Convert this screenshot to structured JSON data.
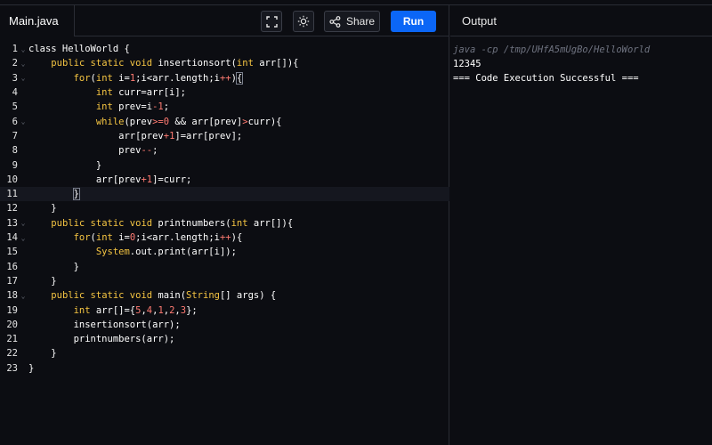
{
  "editor": {
    "file_tab": "Main.java",
    "toolbar": {
      "share_label": "Share",
      "run_label": "Run"
    },
    "lines": [
      {
        "n": "1",
        "fold": true
      },
      {
        "n": "2",
        "fold": true
      },
      {
        "n": "3",
        "fold": true
      },
      {
        "n": "4"
      },
      {
        "n": "5"
      },
      {
        "n": "6",
        "fold": true
      },
      {
        "n": "7"
      },
      {
        "n": "8"
      },
      {
        "n": "9"
      },
      {
        "n": "10"
      },
      {
        "n": "11"
      },
      {
        "n": "12"
      },
      {
        "n": "13",
        "fold": true
      },
      {
        "n": "14",
        "fold": true
      },
      {
        "n": "15"
      },
      {
        "n": "16"
      },
      {
        "n": "17"
      },
      {
        "n": "18",
        "fold": true
      },
      {
        "n": "19"
      },
      {
        "n": "20"
      },
      {
        "n": "21"
      },
      {
        "n": "22"
      },
      {
        "n": "23"
      }
    ],
    "code": {
      "l1": "class HelloWorld {",
      "l2a": "    ",
      "l2kw": "public static void",
      "l2b": " insertionsort(",
      "l2kw2": "int",
      "l2c": " arr[]){",
      "l3a": "        ",
      "l3kw": "for",
      "l3b": "(",
      "l3kw2": "int",
      "l3c": " i=",
      "l3n": "1",
      "l3d": ";i<arr.length;i",
      "l3op": "++",
      "l3e": ")",
      "l4a": "            ",
      "l4kw": "int",
      "l4b": " curr=arr[i];",
      "l5a": "            ",
      "l5kw": "int",
      "l5b": " prev=i",
      "l5op": "-",
      "l5n": "1",
      "l5c": ";",
      "l6a": "            ",
      "l6kw": "while",
      "l6b": "(prev",
      "l6op": ">=",
      "l6n": "0",
      "l6c": " && arr[prev]",
      "l6op2": ">",
      "l6d": "curr){",
      "l7a": "                ",
      "l7b": "arr[prev",
      "l7op": "+",
      "l7n": "1",
      "l7c": "]=arr[prev];",
      "l8a": "                ",
      "l8b": "prev",
      "l8op": "--",
      "l8c": ";",
      "l9": "            }",
      "l10a": "            ",
      "l10b": "arr[prev",
      "l10op": "+",
      "l10n": "1",
      "l10c": "]=curr;",
      "l11a": "        ",
      "l11b": "}",
      "l12": "    }",
      "l13a": "    ",
      "l13kw": "public static void",
      "l13b": " printnumbers(",
      "l13kw2": "int",
      "l13c": " arr[]){",
      "l14a": "        ",
      "l14kw": "for",
      "l14b": "(",
      "l14kw2": "int",
      "l14c": " i=",
      "l14n": "0",
      "l14d": ";i<arr.length;i",
      "l14op": "++",
      "l14e": "){",
      "l15a": "            ",
      "l15kw": "System",
      "l15b": ".out.print(arr[i]);",
      "l16": "        }",
      "l17": "    }",
      "l18a": "    ",
      "l18kw": "public static void",
      "l18b": " main(",
      "l18kw2": "String",
      "l18c": "[] args) {",
      "l19a": "        ",
      "l19kw": "int",
      "l19b": " arr[]={",
      "l19n1": "5",
      "l19s1": ",",
      "l19n2": "4",
      "l19s2": ",",
      "l19n3": "1",
      "l19s3": ",",
      "l19n4": "2",
      "l19s4": ",",
      "l19n5": "3",
      "l19c": "};",
      "l20": "        insertionsort(arr);",
      "l21": "        printnumbers(arr);",
      "l22": "    }",
      "l23": "}"
    }
  },
  "output": {
    "title": "Output",
    "command": "java -cp /tmp/UHfA5mUgBo/HelloWorld",
    "result": "12345",
    "status": "=== Code Execution Successful ==="
  },
  "colors": {
    "run_button": "#0b66f6",
    "keyword": "#f5c542",
    "number": "#ff7b72",
    "background": "#0c0d12"
  }
}
